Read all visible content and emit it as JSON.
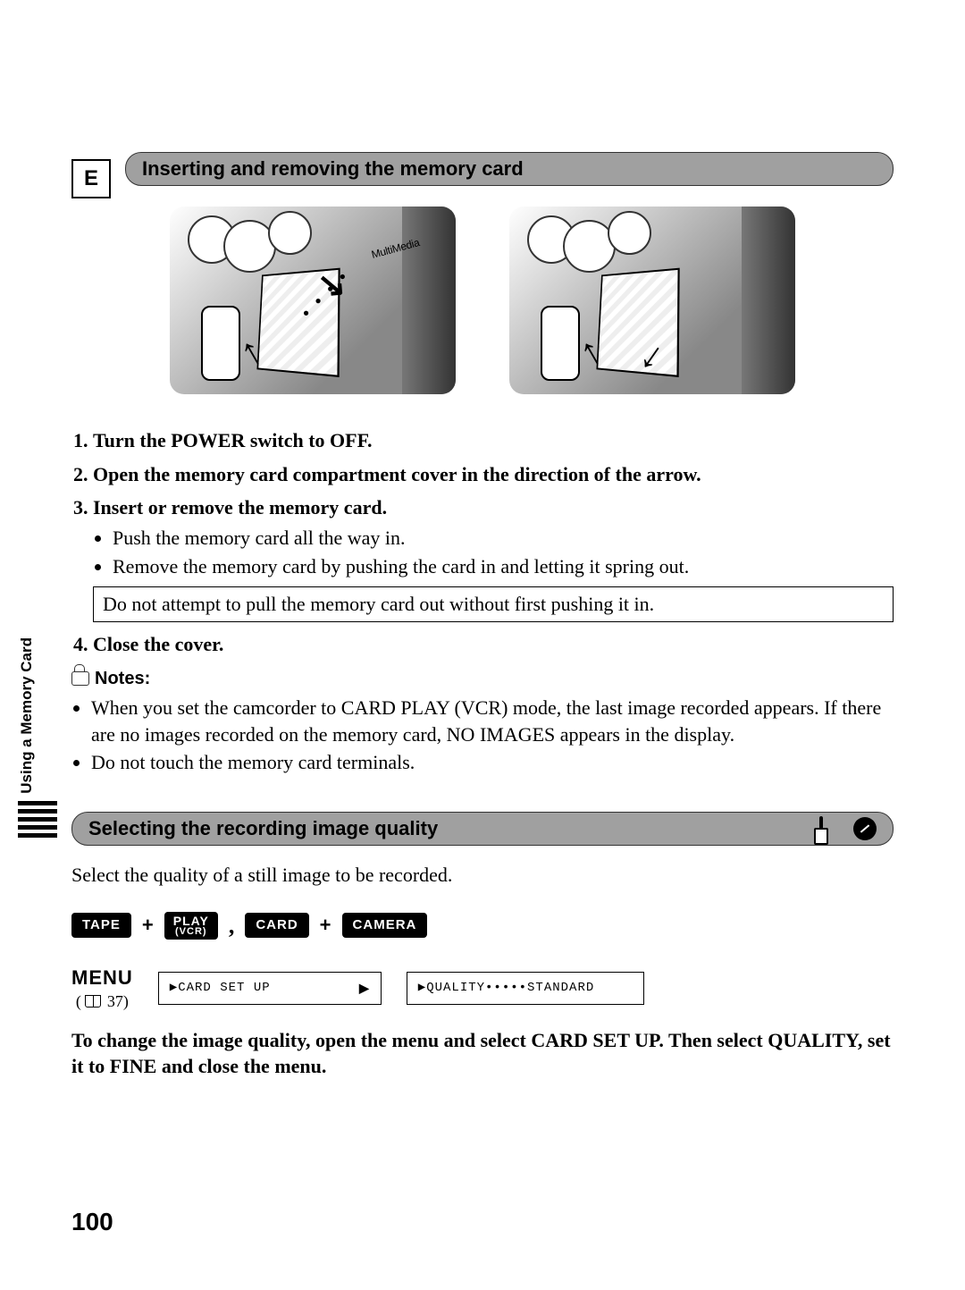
{
  "language_code": "E",
  "section1_title": "Inserting and removing the memory card",
  "image_card_label": "MultiMedia",
  "steps": {
    "s1": "Turn the POWER switch to OFF.",
    "s2": "Open the memory card compartment cover in the direction of the arrow.",
    "s3": "Insert or remove the memory card.",
    "s3_b1": "Push the memory card all the way in.",
    "s3_b2": "Remove the memory card by pushing the card in and letting it spring out.",
    "s3_box": "Do not attempt to pull the memory card out without first pushing it in.",
    "s4": "Close the cover."
  },
  "notes_header": "Notes:",
  "notes": {
    "n1": "When you set the camcorder to CARD PLAY (VCR) mode, the last image recorded appears. If there are no images recorded on the memory card, NO IMAGES appears in the display.",
    "n2": "Do not touch the memory card terminals."
  },
  "section2_title": "Selecting the recording image quality",
  "sidebar_label": "Using a Memory Card",
  "select_line": "Select the quality of a still image to be recorded.",
  "mode_labels": {
    "tape": "TAPE",
    "play": "PLAY",
    "vcr": "(VCR)",
    "card": "CARD",
    "camera": "CAMERA"
  },
  "menu_block": {
    "word": "MENU",
    "page_ref": "37"
  },
  "menu_boxes": {
    "b1_text": "CARD SET UP",
    "b2_text": "QUALITY•••••STANDARD"
  },
  "final_para": "To change the image quality, open the menu and select CARD SET UP. Then select QUALITY, set it to FINE and close the menu.",
  "page_num": "100"
}
